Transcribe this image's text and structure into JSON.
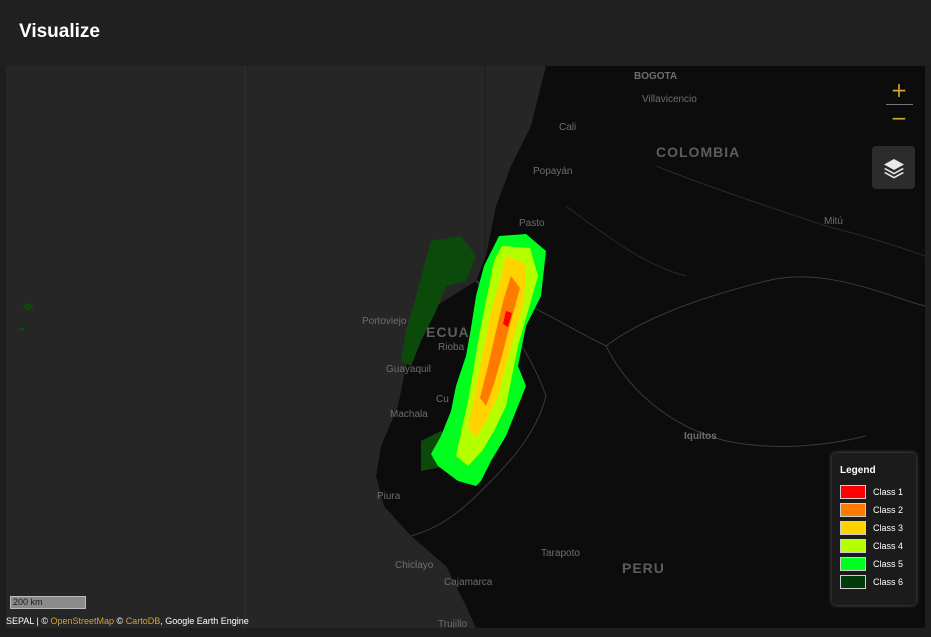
{
  "header": {
    "title": "Visualize"
  },
  "map": {
    "countries": [
      "COLOMBIA",
      "ECUA",
      "PERU"
    ],
    "cities": {
      "bogota": "BOGOTA",
      "villavicencio": "Villavicencio",
      "cali": "Cali",
      "popayan": "Popayán",
      "pasto": "Pasto",
      "mitu": "Mitú",
      "portoviejo": "Portoviejo",
      "riobamba": "Rioba",
      "guayaquil": "Guayaquil",
      "cuenca": "Cu",
      "machala": "Machala",
      "iquitos": "Iquitos",
      "piura": "Piura",
      "tarapoto": "Tarapoto",
      "chiclayo": "Chiclayo",
      "cajamarca": "Cajamarca",
      "trujillo": "Trujillo"
    },
    "zoom_in_label": "+",
    "zoom_out_label": "−",
    "layers_icon": "layers-icon",
    "scale_label": "200 km"
  },
  "legend": {
    "title": "Legend",
    "items": [
      {
        "label": "Class 1",
        "color": "#ff0000"
      },
      {
        "label": "Class 2",
        "color": "#ff7a00"
      },
      {
        "label": "Class 3",
        "color": "#ffd200"
      },
      {
        "label": "Class 4",
        "color": "#b4ff00"
      },
      {
        "label": "Class 5",
        "color": "#00ff1e"
      },
      {
        "label": "Class 6",
        "color": "#003c0a"
      }
    ]
  },
  "attribution": {
    "prefix": "SEPAL | © ",
    "osm": "OpenStreetMap",
    "sep": " © ",
    "carto": "CartoDB",
    "suffix": ", Google Earth Engine"
  }
}
